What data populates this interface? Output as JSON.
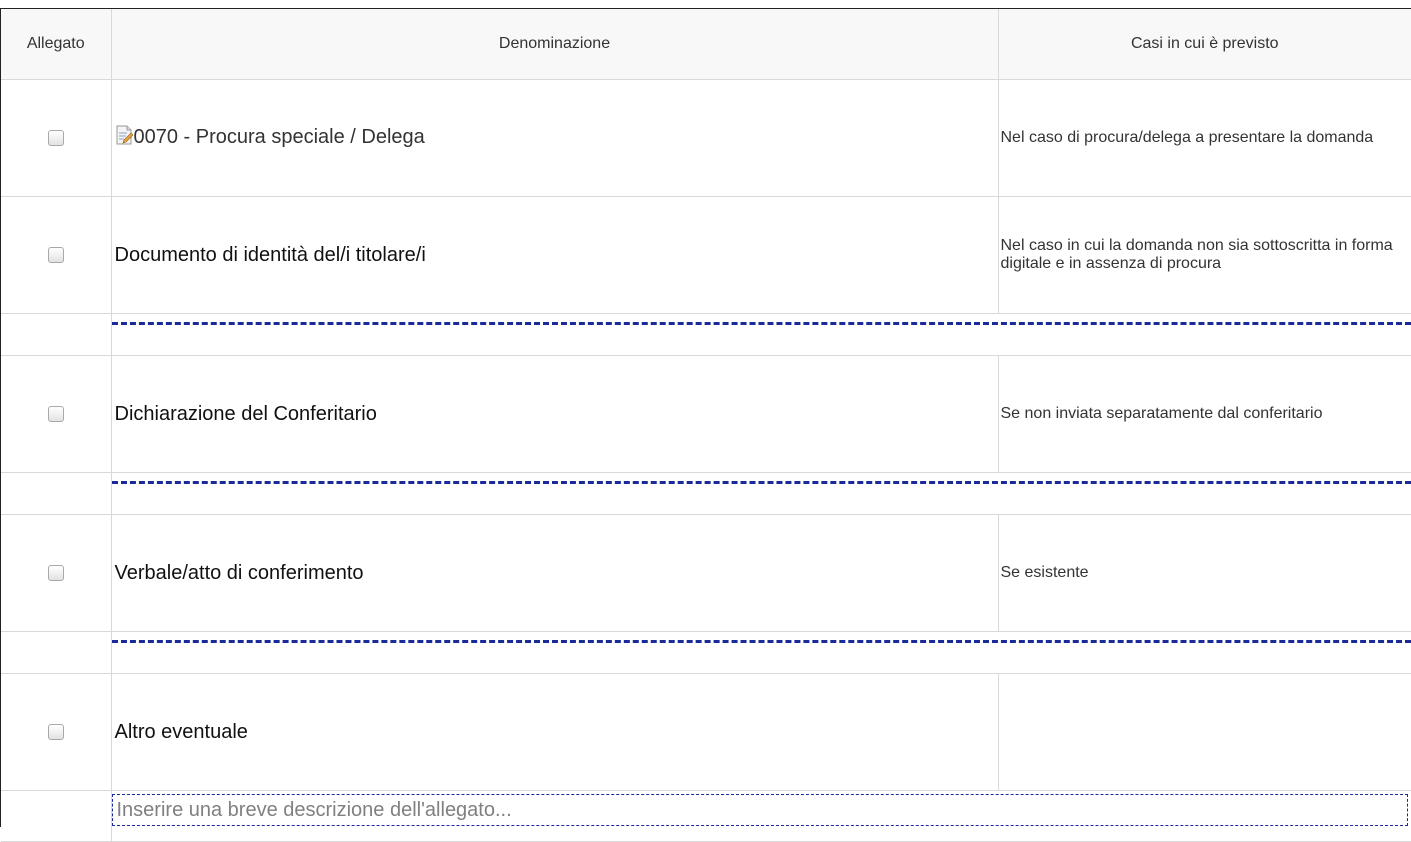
{
  "table": {
    "headers": {
      "allegato": "Allegato",
      "denominazione": "Denominazione",
      "casi": "Casi in cui è previsto"
    },
    "rows": [
      {
        "name": "0070 - Procura speciale / Delega",
        "cases": "Nel caso di procura/delega a presentare la domanda",
        "icon": "edit-document-icon"
      },
      {
        "name": "Documento di identità del/i titolare/i",
        "cases": "Nel caso in cui la domanda non sia sottoscritta in forma digitale e in assenza di procura"
      },
      {
        "name": "Dichiarazione del Conferitario",
        "cases": "Se non inviata separatamente dal conferitario"
      },
      {
        "name": "Verbale/atto di conferimento",
        "cases": "Se esistente"
      },
      {
        "name": "Altro eventuale",
        "cases": ""
      }
    ],
    "description_placeholder": "Inserire una breve descrizione dell'allegato..."
  },
  "colors": {
    "header_bg": "#f8f8f8",
    "dashed_accent": "#1a2a99",
    "grid": "#d9d9d9"
  }
}
